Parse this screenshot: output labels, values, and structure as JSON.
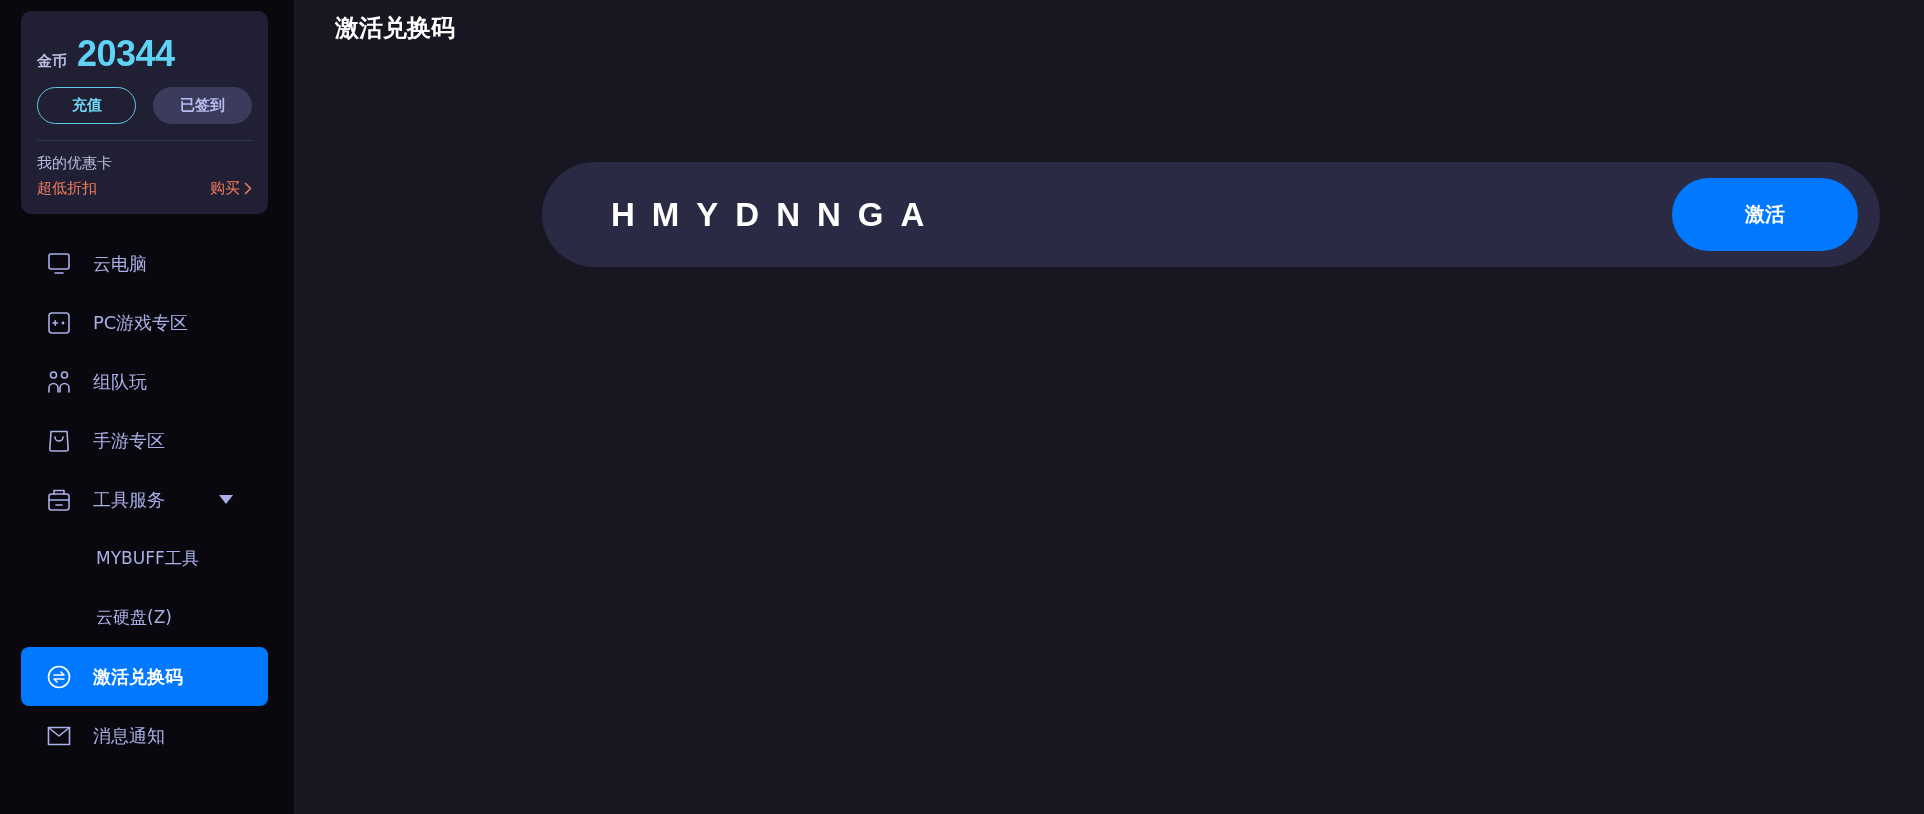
{
  "wallet": {
    "label": "金币",
    "amount": "20344",
    "buttons": [
      {
        "label": "充值",
        "kind": "outline"
      },
      {
        "label": "已签到",
        "kind": "filled"
      }
    ],
    "coupon_title": "我的优惠卡",
    "coupon_note": "超低折扣",
    "coupon_link": "购买"
  },
  "nav": [
    {
      "label": "云电脑",
      "selected": false
    },
    {
      "label": "PC游戏专区",
      "selected": false
    },
    {
      "label": "组队玩",
      "selected": false
    },
    {
      "label": "手游专区",
      "selected": false
    },
    {
      "label": "工具服务",
      "selected": false,
      "expanded": true,
      "children": [
        {
          "label": "MYBUFF工具",
          "selected": false
        },
        {
          "label": "云硬盘(Z)",
          "selected": false
        }
      ]
    },
    {
      "label": "激活兑换码",
      "selected": true
    },
    {
      "label": "消息通知",
      "selected": false
    }
  ],
  "main": {
    "title": "激活兑换码",
    "code_field": {
      "value": "HMYDNNGA"
    },
    "activate_button": "激活"
  }
}
